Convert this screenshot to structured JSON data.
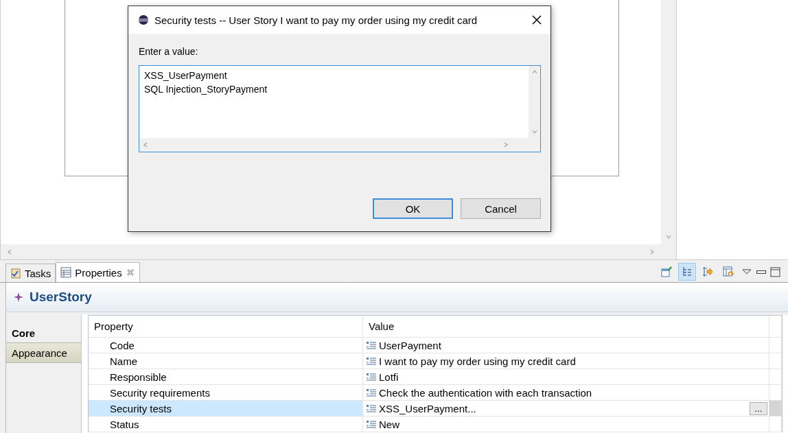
{
  "dialog": {
    "title": "Security tests -- User Story I want to pay my order using my credit card",
    "prompt": "Enter a value:",
    "lines": [
      "XSS_UserPayment",
      "SQL Injection_StoryPayment"
    ],
    "buttons": [
      {
        "label": "OK",
        "selected": true
      },
      {
        "label": "Cancel",
        "selected": false
      }
    ]
  },
  "view_tabs": [
    {
      "label": "Tasks",
      "kind": "tasks",
      "selected": false
    },
    {
      "label": "Properties",
      "kind": "properties",
      "selected": true
    }
  ],
  "toolbar": [
    {
      "kind": "pin",
      "selected": false
    },
    {
      "kind": "tree",
      "selected": true
    },
    {
      "kind": "filter",
      "selected": false
    },
    {
      "kind": "restore",
      "selected": false
    }
  ],
  "element_title": "UserStory",
  "side_tabs": [
    {
      "label": "Core",
      "selected": true
    },
    {
      "label": "Appearance",
      "selected": false
    }
  ],
  "table": {
    "columns": [
      "Property",
      "Value"
    ],
    "rows": [
      {
        "property": "Code",
        "value": "UserPayment",
        "selected": false
      },
      {
        "property": "Name",
        "value": "I want to pay my order using my credit card",
        "selected": false
      },
      {
        "property": "Responsible",
        "value": "Lotfi",
        "selected": false
      },
      {
        "property": "Security requirements",
        "value": "Check the authentication with each transaction",
        "selected": false
      },
      {
        "property": "Security tests",
        "value": "XSS_UserPayment...",
        "selected": true,
        "button": "..."
      },
      {
        "property": "Status",
        "value": "New",
        "selected": false
      }
    ]
  }
}
